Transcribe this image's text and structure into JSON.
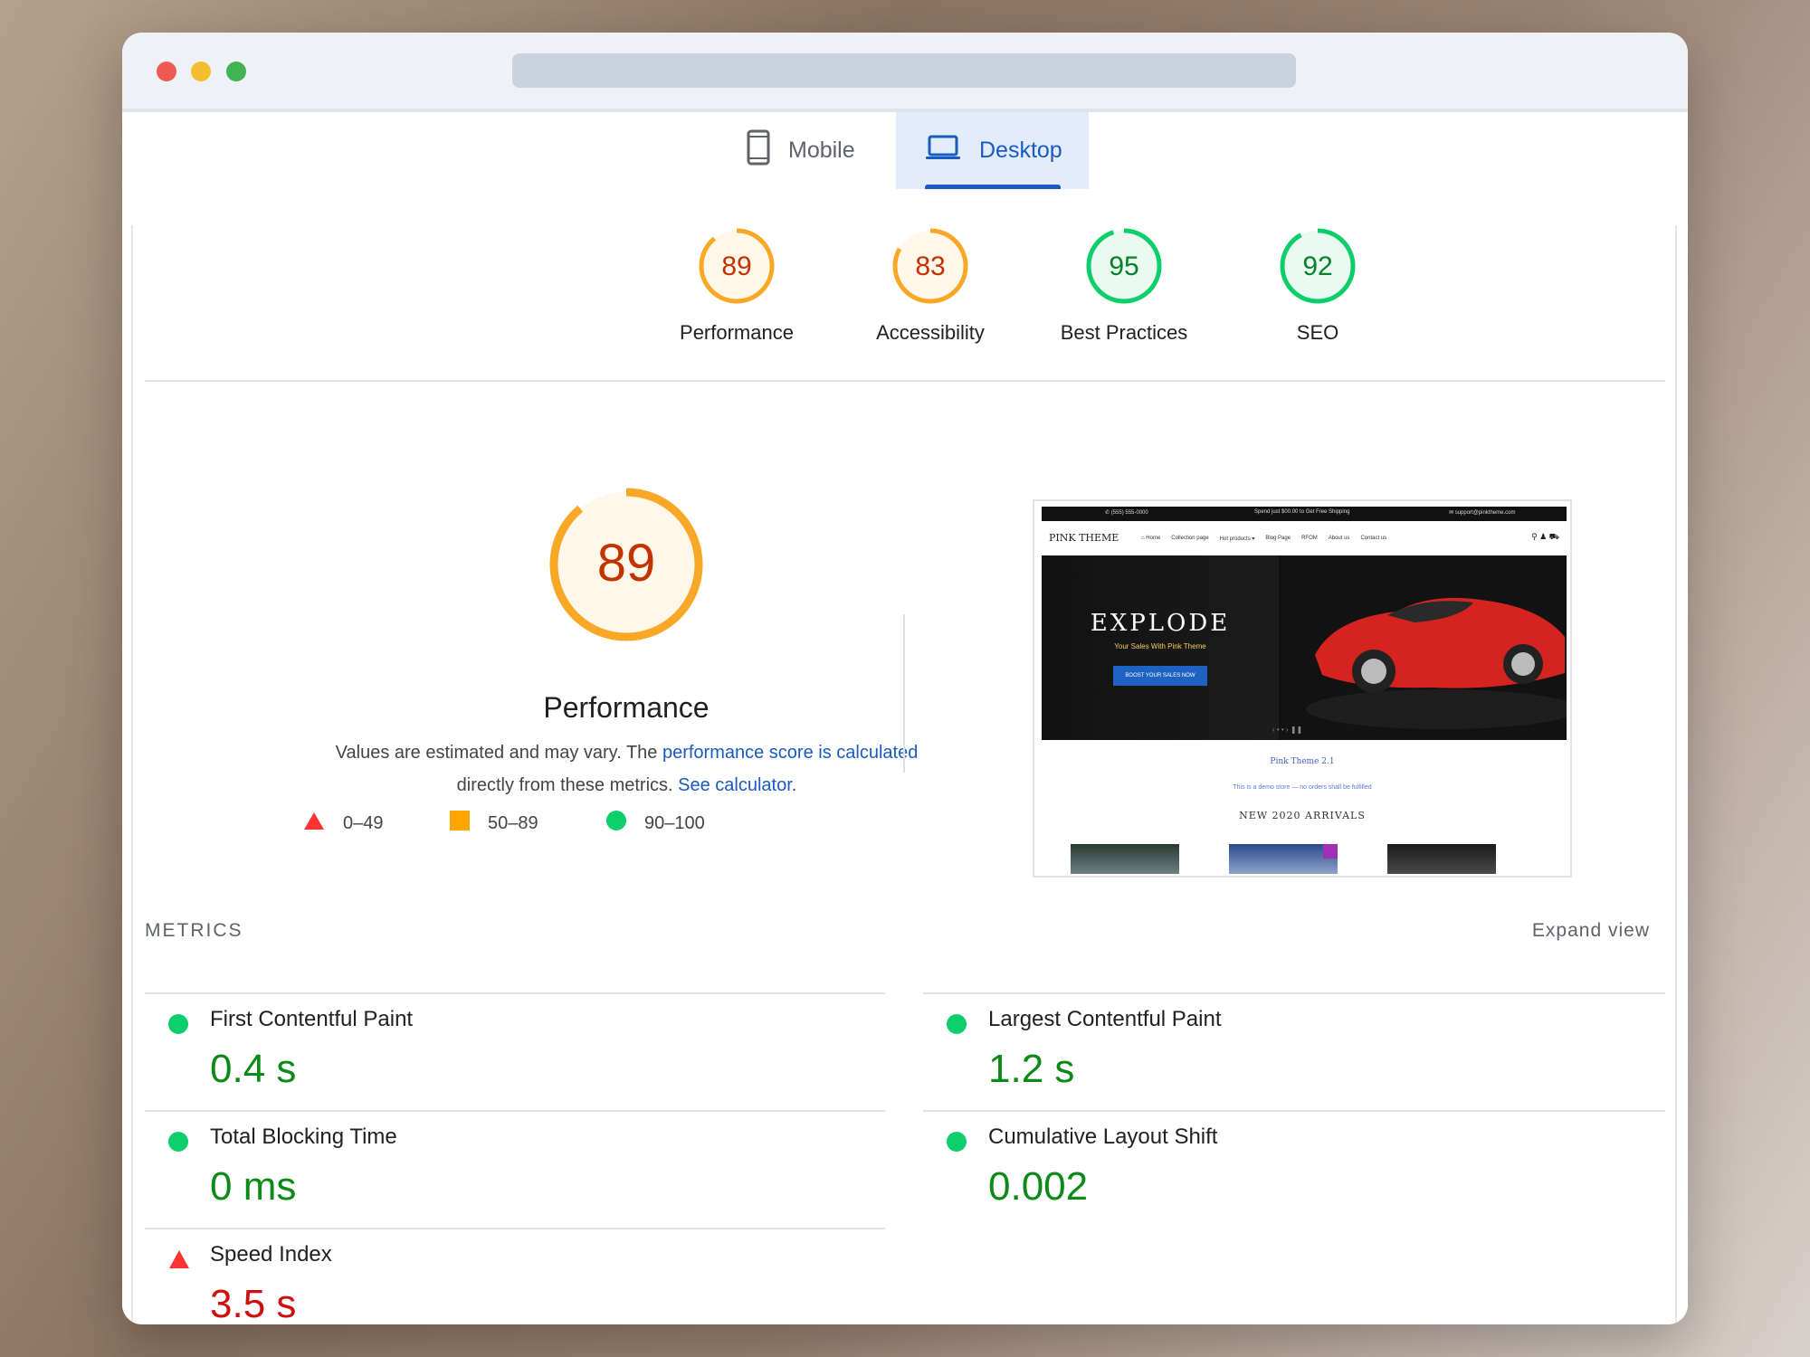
{
  "tabs": {
    "mobile": "Mobile",
    "desktop": "Desktop"
  },
  "gauges": [
    {
      "score": "89",
      "label": "Performance",
      "value": 89,
      "color": "#f9a825",
      "text_color": "#c33300"
    },
    {
      "score": "83",
      "label": "Accessibility",
      "value": 83,
      "color": "#f9a825",
      "text_color": "#c33300"
    },
    {
      "score": "95",
      "label": "Best Practices",
      "value": 95,
      "color": "#0cce6b",
      "text_color": "#08802c"
    },
    {
      "score": "92",
      "label": "SEO",
      "value": 92,
      "color": "#0cce6b",
      "text_color": "#08802c"
    }
  ],
  "performance": {
    "score": "89",
    "value": 89,
    "title": "Performance",
    "desc_prefix": "Values are estimated and may vary. The ",
    "desc_link1": "performance score is calculated",
    "desc_middle": "directly from these metrics. ",
    "desc_link2": "See calculator",
    "desc_suffix": "."
  },
  "legend": [
    {
      "range": "0–49",
      "shape": "triangle",
      "color": "#ff3333"
    },
    {
      "range": "50–89",
      "shape": "square",
      "color": "#ffa400"
    },
    {
      "range": "90–100",
      "shape": "circle",
      "color": "#0cce6b"
    }
  ],
  "thumbnail": {
    "topbar_left": "✆ (555) 555-0000",
    "topbar_mid": "Spend just $00.00 to Get Free Shipping",
    "topbar_right": "✉ support@pinktheme.com",
    "logo": "PINK THEME",
    "menu": [
      "⌂ Home",
      "Collection page",
      "Hot products ▾",
      "Blog Page",
      "RFOM",
      "About us",
      "Contact us"
    ],
    "hero_title": "EXPLODE",
    "hero_sub": "Your Sales With Pink Theme",
    "hero_button": "BOOST YOUR SALES NOW",
    "hero_dots": "‹ • • › ❚❚",
    "text1": "Pink Theme 2.1",
    "text2": "This is a demo store — no orders shall be fulfilled",
    "text3": "NEW 2020 ARRIVALS"
  },
  "metrics": {
    "header": "METRICS",
    "expand": "Expand view",
    "items": [
      {
        "name": "First Contentful Paint",
        "value": "0.4 s",
        "status": "good"
      },
      {
        "name": "Largest Contentful Paint",
        "value": "1.2 s",
        "status": "good"
      },
      {
        "name": "Total Blocking Time",
        "value": "0 ms",
        "status": "good"
      },
      {
        "name": "Cumulative Layout Shift",
        "value": "0.002",
        "status": "good"
      },
      {
        "name": "Speed Index",
        "value": "3.5 s",
        "status": "bad"
      }
    ]
  }
}
